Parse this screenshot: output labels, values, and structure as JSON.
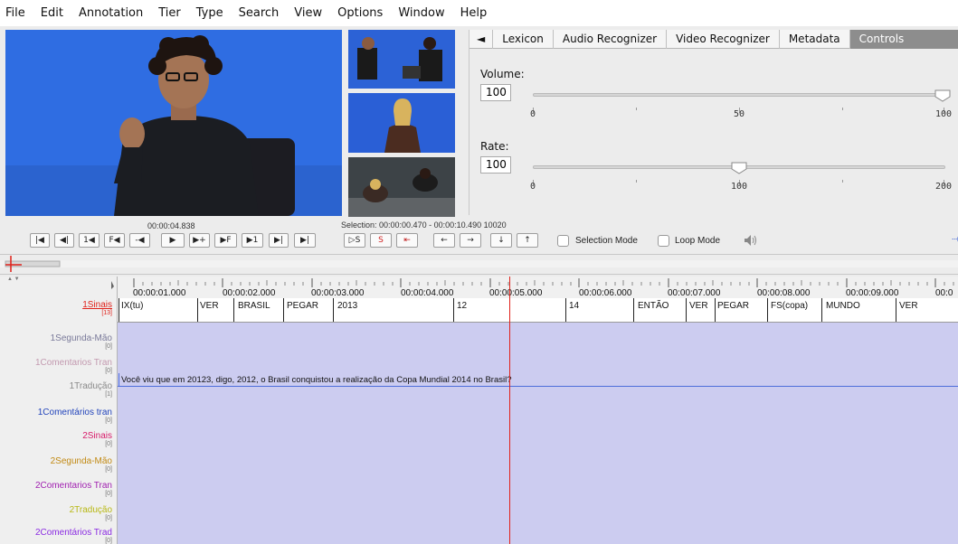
{
  "menu": [
    "File",
    "Edit",
    "Annotation",
    "Tier",
    "Type",
    "Search",
    "View",
    "Options",
    "Window",
    "Help"
  ],
  "tabs": {
    "back_arrow": "◄",
    "items": [
      "Lexicon",
      "Audio Recognizer",
      "Video Recognizer",
      "Metadata",
      "Controls"
    ],
    "active": "Controls"
  },
  "controls": {
    "volume_label": "Volume:",
    "volume_value": "100",
    "volume_ticks": [
      "0",
      "50",
      "100"
    ],
    "rate_label": "Rate:",
    "rate_value": "100",
    "rate_ticks": [
      "0",
      "100",
      "200"
    ]
  },
  "player": {
    "current_time": "00:00:04.838",
    "selection": "Selection: 00:00:00.470 - 00:00:10.490  10020",
    "buttons": [
      "|◀",
      "◀|",
      "1◀",
      "F◀",
      "-◀",
      "▶",
      "▶+",
      "▶F",
      "▶1",
      "▶|",
      "▶|"
    ],
    "sel_buttons": [
      "▷S",
      "S",
      "⇤"
    ],
    "nav_buttons": [
      "←",
      "→",
      "↓",
      "↑"
    ],
    "selection_mode": "Selection Mode",
    "loop_mode": "Loop Mode",
    "volume_icon": "speaker-icon"
  },
  "timeline": {
    "times": [
      "00:00:01.000",
      "00:00:02.000",
      "00:00:03.000",
      "00:00:04.000",
      "00:00:05.000",
      "00:00:06.000",
      "00:00:07.000",
      "00:00:08.000",
      "00:00:09.000",
      "00:0"
    ],
    "tiers": [
      {
        "name": "1Sinais",
        "count": "[13]",
        "color": "#e0211a"
      },
      {
        "name": "1Segunda-Mão",
        "count": "[0]",
        "color": "#7a7a9a"
      },
      {
        "name": "1Comentarios Tran",
        "count": "[0]",
        "color": "#c39ab0"
      },
      {
        "name": "1Tradução",
        "count": "[1]",
        "color": "#8a8a8a"
      },
      {
        "name": "1Comentários tran",
        "count": "[0]",
        "color": "#2244bb"
      },
      {
        "name": "2Sinais",
        "count": "[0]",
        "color": "#d81b6a"
      },
      {
        "name": "2Segunda-Mão",
        "count": "[0]",
        "color": "#c28a14"
      },
      {
        "name": "2Comentarios Tran",
        "count": "[0]",
        "color": "#a020b0"
      },
      {
        "name": "2Tradução",
        "count": "[0]",
        "color": "#b8b814"
      },
      {
        "name": "2Comentários Trad",
        "count": "[0]",
        "color": "#8a2be2"
      }
    ],
    "annotations": [
      "IX(tu)",
      "VER",
      "BRASIL",
      "PEGAR",
      "2013",
      "12",
      "14",
      "ENTÃO",
      "VER",
      "PEGAR",
      "FS(copa)",
      "MUNDO",
      "VER"
    ],
    "translation": "Você viu que em 20123, digo, 2012, o Brasil conquistou a realização da Copa Mundial 2014 no Brasil?"
  }
}
